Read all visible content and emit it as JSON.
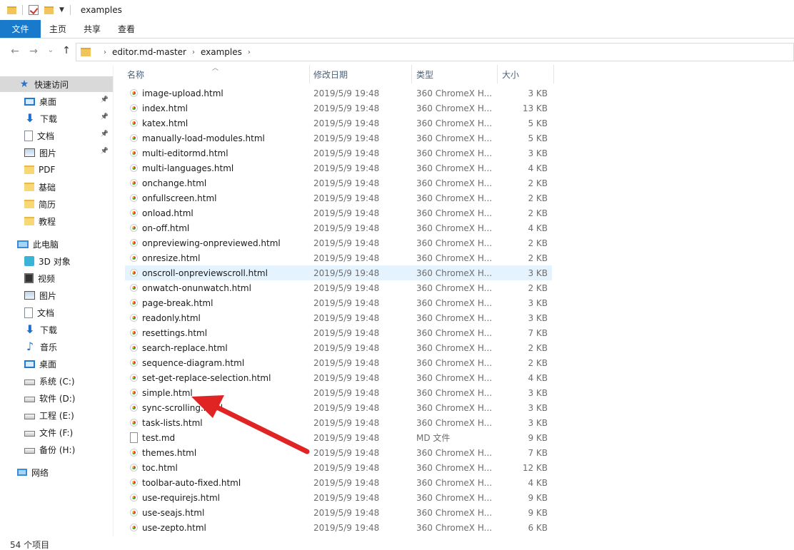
{
  "window": {
    "title": "examples",
    "colors": {
      "accent": "#1979ca",
      "hover_row": "#e5f3ff",
      "arrow": "#e02424"
    }
  },
  "ribbon": {
    "tabs": [
      "文件",
      "主页",
      "共享",
      "查看"
    ]
  },
  "address": {
    "crumbs": [
      "editor.md-master",
      "examples"
    ]
  },
  "sidebar": {
    "quick_access": "快速访问",
    "quick_items": [
      {
        "label": "桌面",
        "icon": "desktop-icon",
        "pinned": true
      },
      {
        "label": "下载",
        "icon": "download-icon",
        "pinned": true
      },
      {
        "label": "文档",
        "icon": "document-icon",
        "pinned": true
      },
      {
        "label": "图片",
        "icon": "pictures-icon",
        "pinned": true
      },
      {
        "label": "PDF",
        "icon": "folder-icon",
        "pinned": false
      },
      {
        "label": "基础",
        "icon": "folder-icon",
        "pinned": false
      },
      {
        "label": "简历",
        "icon": "folder-icon",
        "pinned": false
      },
      {
        "label": "教程",
        "icon": "folder-icon",
        "pinned": false
      }
    ],
    "this_pc": "此电脑",
    "pc_items": [
      {
        "label": "3D 对象",
        "icon": "3d-objects-icon"
      },
      {
        "label": "视频",
        "icon": "video-icon"
      },
      {
        "label": "图片",
        "icon": "pictures-icon"
      },
      {
        "label": "文档",
        "icon": "document-icon"
      },
      {
        "label": "下载",
        "icon": "download-icon"
      },
      {
        "label": "音乐",
        "icon": "music-icon"
      },
      {
        "label": "桌面",
        "icon": "desktop-icon"
      },
      {
        "label": "系统 (C:)",
        "icon": "system-drive-icon"
      },
      {
        "label": "软件 (D:)",
        "icon": "drive-icon"
      },
      {
        "label": "工程 (E:)",
        "icon": "drive-icon"
      },
      {
        "label": "文件 (F:)",
        "icon": "drive-icon"
      },
      {
        "label": "备份 (H:)",
        "icon": "drive-icon"
      }
    ],
    "network": "网络"
  },
  "columns": {
    "name": "名称",
    "date": "修改日期",
    "type": "类型",
    "size": "大小"
  },
  "files": [
    {
      "name": "image-upload.html",
      "date": "2019/5/9 19:48",
      "type": "360 ChromeX H...",
      "size": "3 KB"
    },
    {
      "name": "index.html",
      "date": "2019/5/9 19:48",
      "type": "360 ChromeX H...",
      "size": "13 KB"
    },
    {
      "name": "katex.html",
      "date": "2019/5/9 19:48",
      "type": "360 ChromeX H...",
      "size": "5 KB"
    },
    {
      "name": "manually-load-modules.html",
      "date": "2019/5/9 19:48",
      "type": "360 ChromeX H...",
      "size": "5 KB"
    },
    {
      "name": "multi-editormd.html",
      "date": "2019/5/9 19:48",
      "type": "360 ChromeX H...",
      "size": "3 KB"
    },
    {
      "name": "multi-languages.html",
      "date": "2019/5/9 19:48",
      "type": "360 ChromeX H...",
      "size": "4 KB"
    },
    {
      "name": "onchange.html",
      "date": "2019/5/9 19:48",
      "type": "360 ChromeX H...",
      "size": "2 KB"
    },
    {
      "name": "onfullscreen.html",
      "date": "2019/5/9 19:48",
      "type": "360 ChromeX H...",
      "size": "2 KB"
    },
    {
      "name": "onload.html",
      "date": "2019/5/9 19:48",
      "type": "360 ChromeX H...",
      "size": "2 KB"
    },
    {
      "name": "on-off.html",
      "date": "2019/5/9 19:48",
      "type": "360 ChromeX H...",
      "size": "4 KB"
    },
    {
      "name": "onpreviewing-onpreviewed.html",
      "date": "2019/5/9 19:48",
      "type": "360 ChromeX H...",
      "size": "2 KB"
    },
    {
      "name": "onresize.html",
      "date": "2019/5/9 19:48",
      "type": "360 ChromeX H...",
      "size": "2 KB"
    },
    {
      "name": "onscroll-onpreviewscroll.html",
      "date": "2019/5/9 19:48",
      "type": "360 ChromeX H...",
      "size": "3 KB",
      "hover": true
    },
    {
      "name": "onwatch-onunwatch.html",
      "date": "2019/5/9 19:48",
      "type": "360 ChromeX H...",
      "size": "2 KB"
    },
    {
      "name": "page-break.html",
      "date": "2019/5/9 19:48",
      "type": "360 ChromeX H...",
      "size": "3 KB"
    },
    {
      "name": "readonly.html",
      "date": "2019/5/9 19:48",
      "type": "360 ChromeX H...",
      "size": "3 KB"
    },
    {
      "name": "resettings.html",
      "date": "2019/5/9 19:48",
      "type": "360 ChromeX H...",
      "size": "7 KB"
    },
    {
      "name": "search-replace.html",
      "date": "2019/5/9 19:48",
      "type": "360 ChromeX H...",
      "size": "2 KB"
    },
    {
      "name": "sequence-diagram.html",
      "date": "2019/5/9 19:48",
      "type": "360 ChromeX H...",
      "size": "2 KB"
    },
    {
      "name": "set-get-replace-selection.html",
      "date": "2019/5/9 19:48",
      "type": "360 ChromeX H...",
      "size": "4 KB"
    },
    {
      "name": "simple.html",
      "date": "2019/5/9 19:48",
      "type": "360 ChromeX H...",
      "size": "3 KB"
    },
    {
      "name": "sync-scrolling.html",
      "date": "2019/5/9 19:48",
      "type": "360 ChromeX H...",
      "size": "3 KB"
    },
    {
      "name": "task-lists.html",
      "date": "2019/5/9 19:48",
      "type": "360 ChromeX H...",
      "size": "3 KB"
    },
    {
      "name": "test.md",
      "date": "2019/5/9 19:48",
      "type": "MD 文件",
      "size": "9 KB",
      "md": true
    },
    {
      "name": "themes.html",
      "date": "2019/5/9 19:48",
      "type": "360 ChromeX H...",
      "size": "7 KB"
    },
    {
      "name": "toc.html",
      "date": "2019/5/9 19:48",
      "type": "360 ChromeX H...",
      "size": "12 KB"
    },
    {
      "name": "toolbar-auto-fixed.html",
      "date": "2019/5/9 19:48",
      "type": "360 ChromeX H...",
      "size": "4 KB"
    },
    {
      "name": "use-requirejs.html",
      "date": "2019/5/9 19:48",
      "type": "360 ChromeX H...",
      "size": "9 KB"
    },
    {
      "name": "use-seajs.html",
      "date": "2019/5/9 19:48",
      "type": "360 ChromeX H...",
      "size": "9 KB"
    },
    {
      "name": "use-zepto.html",
      "date": "2019/5/9 19:48",
      "type": "360 ChromeX H...",
      "size": "6 KB"
    }
  ],
  "status": {
    "count_text": "54 个项目"
  }
}
